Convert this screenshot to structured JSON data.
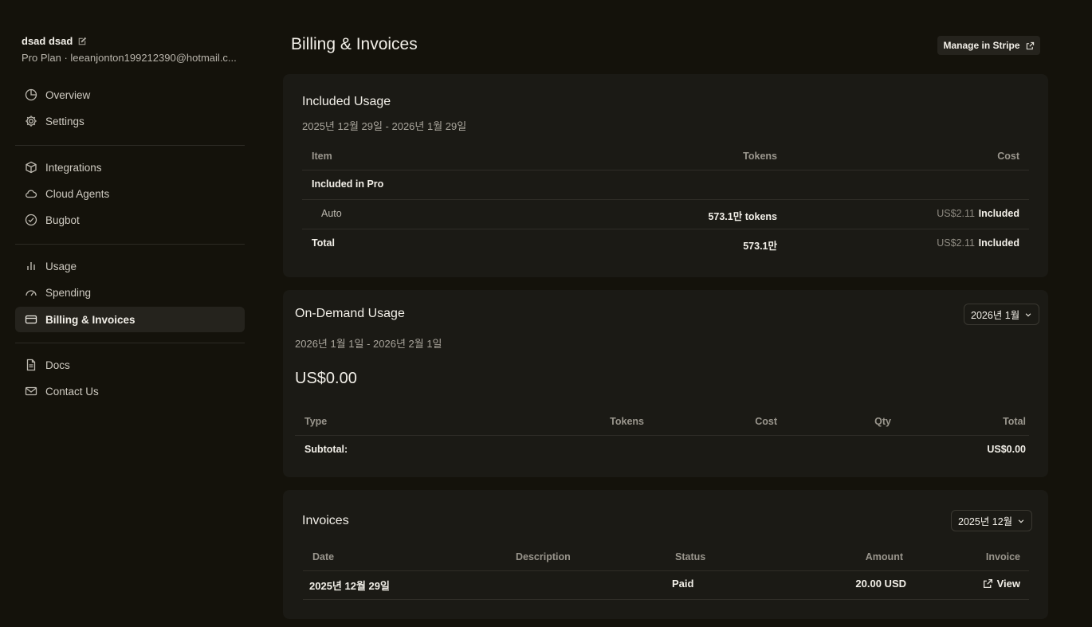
{
  "user": {
    "name": "dsad dsad",
    "subtitle": "Pro Plan · leeanjonton199212390@hotmail.c..."
  },
  "sidebar": {
    "items": [
      {
        "label": "Overview",
        "icon": "pie-chart-icon"
      },
      {
        "label": "Settings",
        "icon": "gear-icon"
      },
      {
        "label": "Integrations",
        "icon": "cube-icon"
      },
      {
        "label": "Cloud Agents",
        "icon": "cloud-icon"
      },
      {
        "label": "Bugbot",
        "icon": "check-circle-icon"
      },
      {
        "label": "Usage",
        "icon": "bar-chart-icon"
      },
      {
        "label": "Spending",
        "icon": "gauge-icon"
      },
      {
        "label": "Billing & Invoices",
        "icon": "credit-card-icon",
        "active": true
      },
      {
        "label": "Docs",
        "icon": "document-icon"
      },
      {
        "label": "Contact Us",
        "icon": "mail-icon"
      }
    ]
  },
  "header": {
    "title": "Billing & Invoices",
    "manage_label": "Manage in Stripe"
  },
  "included": {
    "title": "Included Usage",
    "range": "2025년 12월 29일 - 2026년 1월 29일",
    "columns": [
      "Item",
      "Tokens",
      "Cost"
    ],
    "group_label": "Included in Pro",
    "rows": [
      {
        "item": "Auto",
        "tokens": "573.1만 tokens",
        "cost": "US$2.11",
        "status": "Included"
      }
    ],
    "total": {
      "label": "Total",
      "tokens": "573.1만",
      "cost": "US$2.11",
      "status": "Included"
    }
  },
  "ondemand": {
    "title": "On-Demand Usage",
    "month": "2026년 1월",
    "range": "2026년 1월 1일 - 2026년 2월 1일",
    "amount": "US$0.00",
    "columns": [
      "Type",
      "Tokens",
      "Cost",
      "Qty",
      "Total"
    ],
    "subtotal_label": "Subtotal:",
    "subtotal_value": "US$0.00"
  },
  "invoices": {
    "title": "Invoices",
    "month": "2025년 12월",
    "columns": [
      "Date",
      "Description",
      "Status",
      "Amount",
      "Invoice"
    ],
    "rows": [
      {
        "date": "2025년 12월 29일",
        "description": "",
        "status": "Paid",
        "amount": "20.00 USD",
        "invoice": "View"
      }
    ]
  }
}
